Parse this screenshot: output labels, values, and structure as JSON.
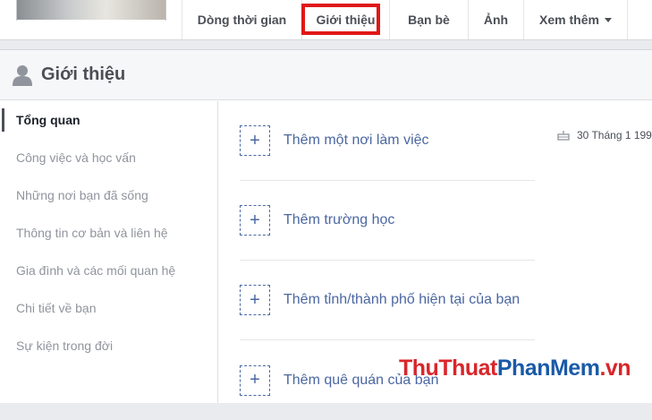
{
  "nav": {
    "tabs": [
      {
        "label": "Dòng thời gian"
      },
      {
        "label": "Giới thiệu"
      },
      {
        "label": "Bạn bè"
      },
      {
        "label": "Ảnh"
      },
      {
        "label": "Xem thêm"
      }
    ],
    "active_tab": "Giới thiệu",
    "highlight_color": "#e01818"
  },
  "card": {
    "title": "Giới thiệu",
    "icon": "person-icon"
  },
  "sidebar": {
    "items": [
      {
        "label": "Tổng quan"
      },
      {
        "label": "Công việc và học vấn"
      },
      {
        "label": "Những nơi bạn đã sống"
      },
      {
        "label": "Thông tin cơ bản và liên hệ"
      },
      {
        "label": "Gia đình và các mối quan hệ"
      },
      {
        "label": "Chi tiết về bạn"
      },
      {
        "label": "Sự kiện trong đời"
      }
    ],
    "active": "Tổng quan"
  },
  "main": {
    "add_items": [
      {
        "label": "Thêm một nơi làm việc",
        "icon": "plus-icon"
      },
      {
        "label": "Thêm trường học",
        "icon": "plus-icon"
      },
      {
        "label": "Thêm tỉnh/thành phố hiện tại của bạn",
        "icon": "plus-icon"
      },
      {
        "label": "Thêm quê quán của bạn",
        "icon": "plus-icon"
      }
    ],
    "link_color": "#4b67a1"
  },
  "birthday": {
    "text": "30 Tháng 1 199",
    "icon": "cake-icon"
  },
  "watermark": {
    "part1": "ThuThuat",
    "part2": "PhanMem",
    "part3": ".vn"
  }
}
